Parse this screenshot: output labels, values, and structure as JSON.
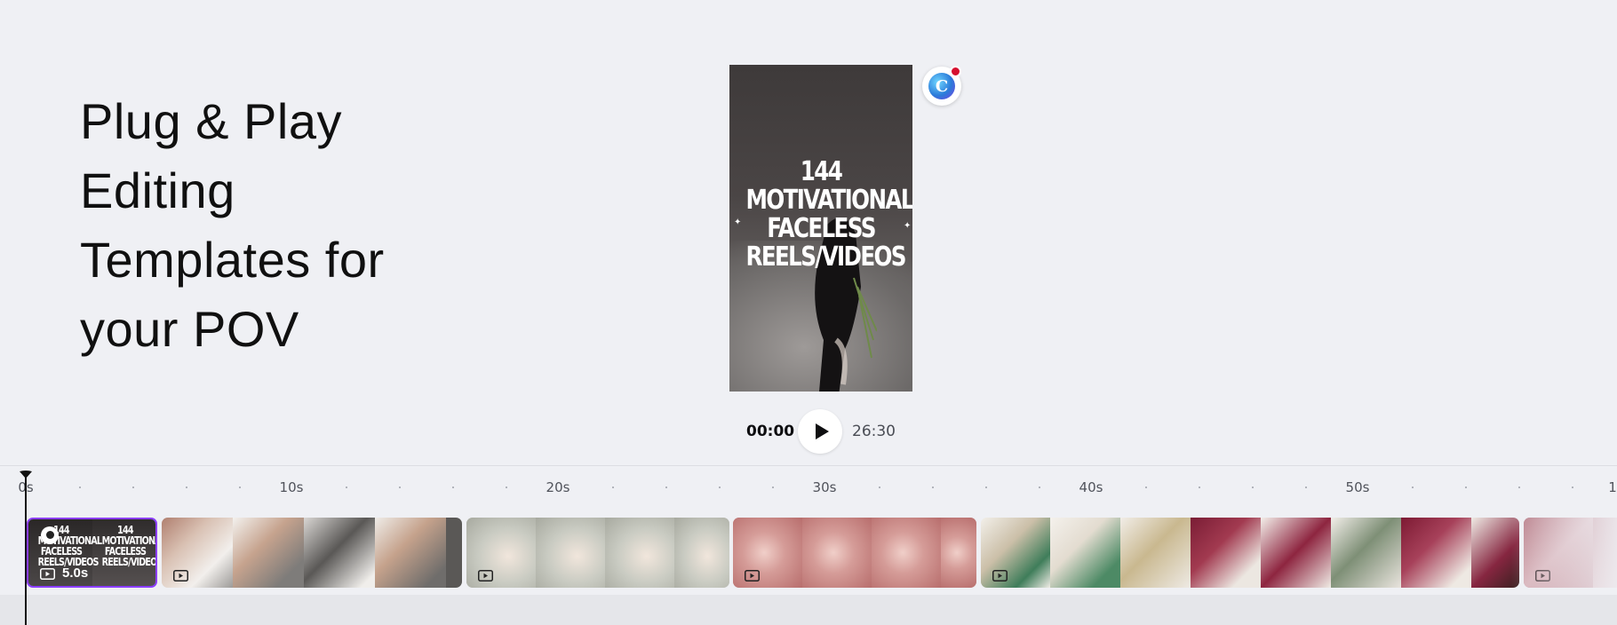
{
  "headline": {
    "lines": [
      "Plug & Play",
      "Editing",
      "Templates for",
      "your POV"
    ]
  },
  "preview": {
    "title_lines": [
      "144",
      "MOTIVATIONAL",
      "FACELESS",
      "REELS/VIDEOS"
    ]
  },
  "assistant": {
    "icon": "canva-assistant-icon",
    "badge_color": "#d6102f"
  },
  "playback": {
    "current_time": "00:00",
    "total_time": "26:30",
    "play_icon": "play-icon"
  },
  "ruler": {
    "labels": [
      "0s",
      "10s",
      "20s",
      "30s",
      "40s",
      "50s",
      "1"
    ]
  },
  "clips": {
    "first": {
      "title_lines": [
        "144",
        "MOTIVATIONAL",
        "FACELESS",
        "REELS/VIDEOS"
      ],
      "duration": "5.0s"
    }
  },
  "colors": {
    "selection": "#8b3dff",
    "background": "#eff0f4"
  }
}
